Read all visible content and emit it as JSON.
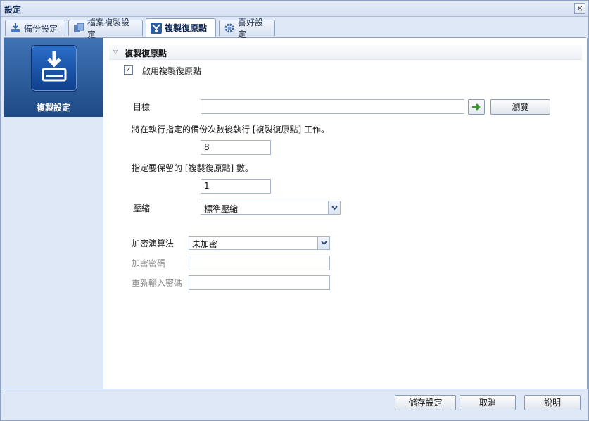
{
  "window": {
    "title": "設定",
    "close_glyph": "×"
  },
  "tabs": [
    {
      "label": "備份設定",
      "icon": "backup-icon",
      "active": false
    },
    {
      "label": "檔案複製設定",
      "icon": "file-copy-icon",
      "active": false
    },
    {
      "label": "複製復原點",
      "icon": "copy-recovery-point-icon",
      "active": true
    },
    {
      "label": "喜好設定",
      "icon": "preferences-gear-icon",
      "active": false
    }
  ],
  "sidebar": {
    "label": "複製設定",
    "icon": "drive-download-icon"
  },
  "section": {
    "title": "複製復原點",
    "enable_label": "啟用複製復原點",
    "enable_checked": true,
    "check_glyph": "✓"
  },
  "form": {
    "destination_label": "目標",
    "destination_value": "",
    "browse_label": "瀏覽",
    "backup_count_text": "將在執行指定的備份次數後執行 [複製復原點] 工作。",
    "backup_count_value": "8",
    "retain_text": "指定要保留的 [複製復原點] 數。",
    "retain_value": "1",
    "compression_label": "壓縮",
    "compression_value": "標準壓縮",
    "encryption_label": "加密演算法",
    "encryption_value": "未加密",
    "password_label": "加密密碼",
    "password_value": "",
    "repassword_label": "重新輸入密碼",
    "repassword_value": ""
  },
  "footer": {
    "save_label": "儲存設定",
    "cancel_label": "取消",
    "help_label": "說明"
  },
  "colors": {
    "accent": "#1e4a86",
    "go_arrow": "#3a9a2a"
  }
}
